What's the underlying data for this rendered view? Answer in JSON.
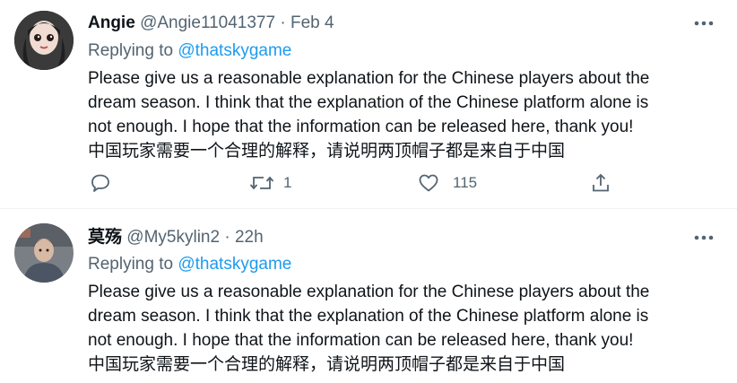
{
  "tweets": [
    {
      "name": "Angie",
      "handle": "@Angie11041377",
      "separator": "·",
      "time": "Feb 4",
      "replying_prefix": "Replying to",
      "replying_to": "@thatskygame",
      "lines": [
        "Please give us a reasonable explanation for the Chinese players about the",
        "dream season. I think that the explanation of the Chinese platform alone is",
        "not enough. I hope that the information can be released here, thank you!",
        "中国玩家需要一个合理的解释，请说明两顶帽子都是来自于中国"
      ],
      "actions": {
        "reply_count": "",
        "retweet_count": "1",
        "like_count": "115"
      },
      "avatar_icon": "user-avatar-icon"
    },
    {
      "name": "莫殇",
      "handle": "@My5kylin2",
      "separator": "·",
      "time": "22h",
      "replying_prefix": "Replying to",
      "replying_to": "@thatskygame",
      "lines": [
        "Please give us a reasonable explanation for the Chinese players about the",
        "dream season. I think that the explanation of the Chinese platform alone is",
        "not enough. I hope that the information can be released here, thank you!",
        "中国玩家需要一个合理的解释，请说明两顶帽子都是来自于中国"
      ],
      "avatar_icon": "user-avatar-icon"
    }
  ],
  "colors": {
    "text": "#0f1419",
    "secondary": "#536471",
    "link": "#1d9bf0",
    "divider": "#eff3f4"
  },
  "icons": [
    "reply-icon",
    "retweet-icon",
    "like-icon",
    "share-icon",
    "more-icon"
  ]
}
